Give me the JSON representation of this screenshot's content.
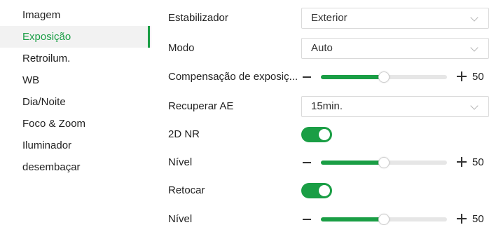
{
  "sidebar": {
    "items": [
      {
        "label": "Imagem",
        "active": false
      },
      {
        "label": "Exposição",
        "active": true
      },
      {
        "label": "Retroilum.",
        "active": false
      },
      {
        "label": "WB",
        "active": false
      },
      {
        "label": "Dia/Noite",
        "active": false
      },
      {
        "label": "Foco & Zoom",
        "active": false
      },
      {
        "label": "Iluminador",
        "active": false
      },
      {
        "label": "desembaçar",
        "active": false
      }
    ]
  },
  "settings": {
    "stabilizer": {
      "label": "Estabilizador",
      "value": "Exterior"
    },
    "mode": {
      "label": "Modo",
      "value": "Auto"
    },
    "exposure_compensation": {
      "label": "Compensação de exposiç...",
      "value": "50",
      "level_percent": 50
    },
    "recover_ae": {
      "label": "Recuperar AE",
      "value": "15min."
    },
    "nr2d": {
      "label": "2D NR",
      "on": true
    },
    "nr2d_level": {
      "label": "Nível",
      "value": "50",
      "level_percent": 50
    },
    "retouch": {
      "label": "Retocar",
      "on": true
    },
    "retouch_level": {
      "label": "Nível",
      "value": "50",
      "level_percent": 50
    }
  },
  "colors": {
    "accent": "#1a9e45",
    "track": "#e6e6e6",
    "active_bg": "#f2f2f2"
  }
}
